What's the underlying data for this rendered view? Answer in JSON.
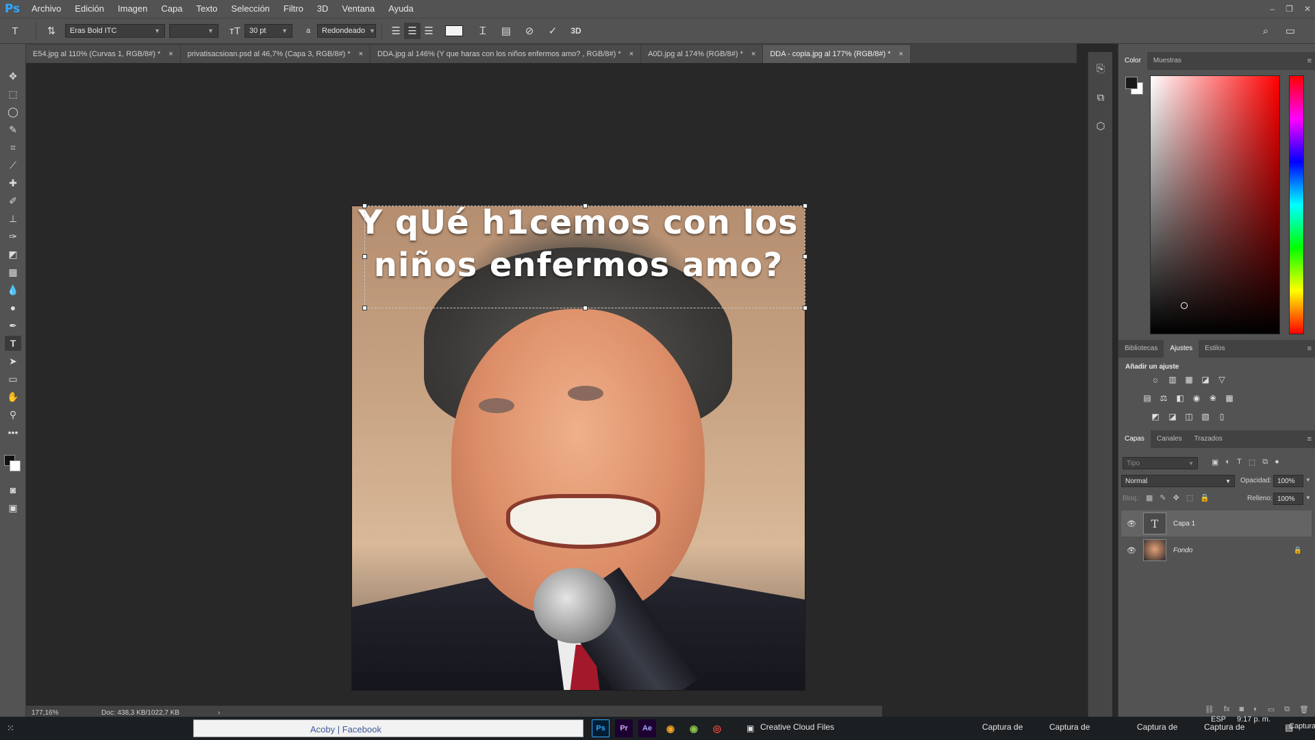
{
  "app": {
    "logo": "Ps",
    "menu": [
      "Archivo",
      "Edición",
      "Imagen",
      "Capa",
      "Texto",
      "Selección",
      "Filtro",
      "3D",
      "Ventana",
      "Ayuda"
    ]
  },
  "options_bar": {
    "font_family": "Eras Bold ITC",
    "font_size": "30 pt",
    "antialias_icon_label": "a",
    "antialias_value": "Redondeado",
    "mode_3d": "3D"
  },
  "tabs": [
    {
      "label": "E54.jpg al 110% (Curvas 1, RGB/8#) *",
      "active": false
    },
    {
      "label": "privatisacsioan.psd al 46,7% (Capa 3, RGB/8#) *",
      "active": false
    },
    {
      "label": "DDA.jpg al 146% (Y que haras con los niños enfermos  amo? , RGB/8#) *",
      "active": false
    },
    {
      "label": "A0D.jpg al 174% (RGB/8#) *",
      "active": false
    },
    {
      "label": "DDA - copia.jpg al 177% (RGB/8#) *",
      "active": true
    }
  ],
  "tab_close": "×",
  "canvas": {
    "text_line1": "Y qUé h1cemos con los",
    "text_line2": "niños enfermos amo?"
  },
  "status": {
    "zoom": "177,16%",
    "doc": "Doc: 438,3 KB/1022,7 KB",
    "arrow": "›"
  },
  "color_panel": {
    "tabs": [
      "Color",
      "Muestras"
    ],
    "foreground": "#1a1a1a",
    "background": "#ffffff"
  },
  "adjust_panel": {
    "tabs": [
      "Bibliotecas",
      "Ajustes",
      "Estilos"
    ],
    "title": "Añadir un ajuste"
  },
  "layers_panel": {
    "tabs": [
      "Capas",
      "Canales",
      "Trazados"
    ],
    "search_placeholder": "Tipo",
    "blend_mode": "Normal",
    "opacity_label": "Opacidad:",
    "opacity_value": "100%",
    "lock_label": "Bloq.:",
    "fill_label": "Relleno:",
    "fill_value": "100%",
    "layers": [
      {
        "name": "Capa 1",
        "type": "text",
        "selected": true
      },
      {
        "name": "Fondo",
        "type": "image",
        "selected": false,
        "locked": true
      }
    ]
  },
  "taskbar": {
    "browser_tab": "Acoby | Facebook",
    "apps": [
      "Ps",
      "Pr",
      "Ae"
    ],
    "cc_label": "Creative Cloud Files",
    "captures": [
      "Captura de",
      "Captura de",
      "Captura de",
      "Captura de",
      "Captura"
    ],
    "lang": "ESP",
    "time": "9:17 p. m."
  }
}
